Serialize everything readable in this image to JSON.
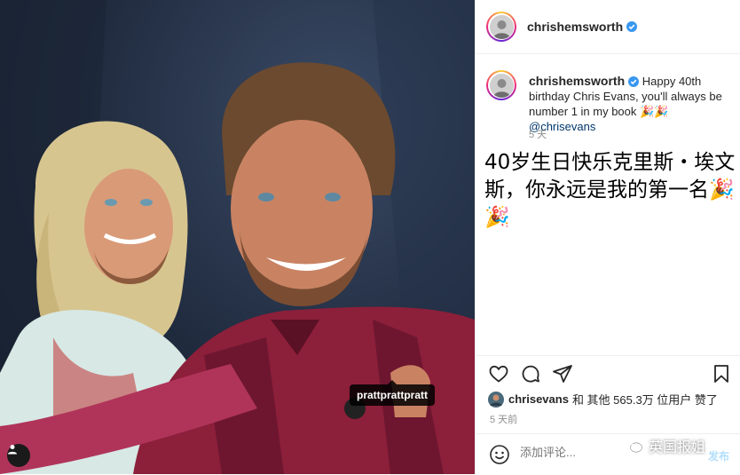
{
  "post": {
    "author": "chrishemsworth",
    "caption_text": "Happy 40th birthday Chris Evans, you'll always be number 1 in my book ",
    "caption_emoji": "🎉🎉",
    "caption_mention": "@chrisevans",
    "caption_time": "5 天",
    "translation": "40岁生日快乐克里斯・埃文斯，你永远是我的第一名🎉🎉",
    "photo_tag": "prattprattpratt",
    "likes_user": "chrisevans",
    "likes_text": "和 其他 565.3万 位用户 赞了",
    "post_time": "5 天前",
    "comment_placeholder": "添加评论...",
    "post_button": "发布",
    "watermark": "英国报姐"
  },
  "colors": {
    "verified": "#3897f0",
    "mention": "#00376b",
    "muted": "#8e8e8e",
    "post_button": "#b2dffc"
  },
  "icons": [
    "verified-badge-icon",
    "heart-icon",
    "comment-icon",
    "share-icon",
    "bookmark-icon",
    "emoji-icon",
    "user-tag-icon"
  ]
}
